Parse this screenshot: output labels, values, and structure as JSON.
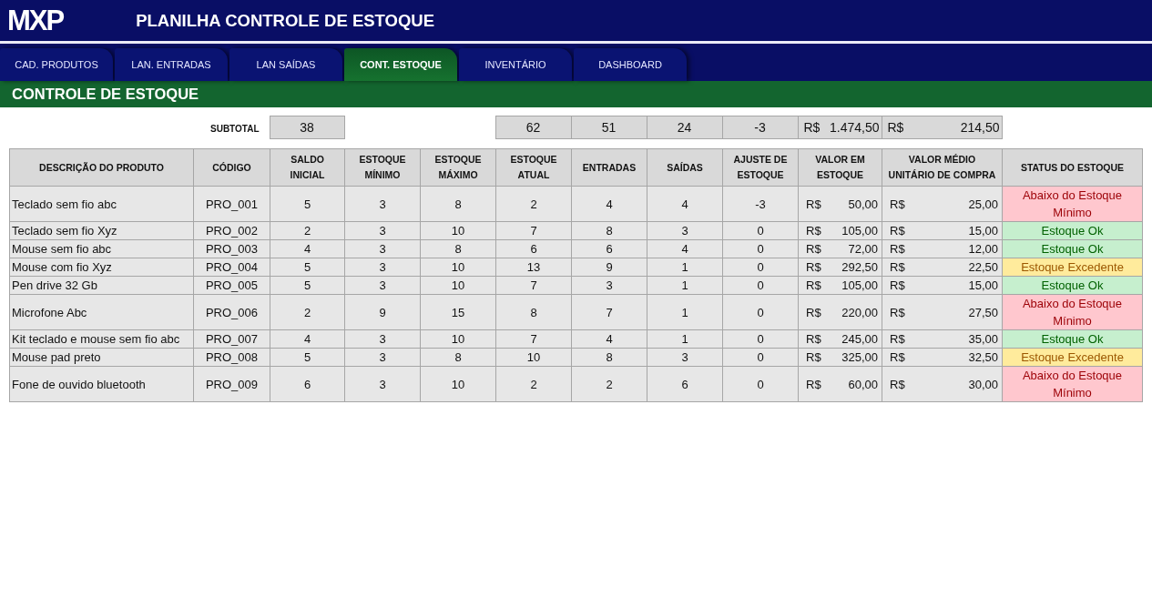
{
  "header": {
    "logo": "MXP",
    "title": "PLANILHA CONTROLE DE ESTOQUE"
  },
  "tabs": [
    {
      "label": "CAD. PRODUTOS",
      "selected": false
    },
    {
      "label": "LAN. ENTRADAS",
      "selected": false
    },
    {
      "label": "LAN SAÍDAS",
      "selected": false
    },
    {
      "label": "CONT. ESTOQUE",
      "selected": true
    },
    {
      "label": "INVENTÁRIO",
      "selected": false
    },
    {
      "label": "DASHBOARD",
      "selected": false
    }
  ],
  "section_title": "CONTROLE DE ESTOQUE",
  "subtotal": {
    "label": "SUBTOTAL",
    "saldo_inicial": "38",
    "estoque_atual": "62",
    "entradas": "51",
    "saidas": "24",
    "ajuste": "-3",
    "valor_em_estoque": {
      "currency": "R$",
      "amount": "1.474,50"
    },
    "valor_medio": {
      "currency": "R$",
      "amount": "214,50"
    }
  },
  "table": {
    "columns": [
      "DESCRIÇÃO DO PRODUTO",
      "CÓDIGO",
      "SALDO INICIAL",
      "ESTOQUE MÍNIMO",
      "ESTOQUE MÁXIMO",
      "ESTOQUE ATUAL",
      "ENTRADAS",
      "SAÍDAS",
      "AJUSTE DE ESTOQUE",
      "VALOR EM ESTOQUE",
      "VALOR MÉDIO UNITÁRIO DE COMPRA",
      "STATUS DO ESTOQUE"
    ],
    "rows": [
      {
        "descricao": "Teclado sem fio abc",
        "codigo": "PRO_001",
        "saldo_inicial": "5",
        "estoque_minimo": "3",
        "estoque_maximo": "8",
        "estoque_atual": "2",
        "entradas": "4",
        "saidas": "4",
        "ajuste": "-3",
        "valor_em_estoque": {
          "currency": "R$",
          "amount": "50,00"
        },
        "valor_medio": {
          "currency": "R$",
          "amount": "25,00"
        },
        "status": {
          "label": "Abaixo do Estoque Mínimo",
          "kind": "low"
        }
      },
      {
        "descricao": "Teclado sem fio Xyz",
        "codigo": "PRO_002",
        "saldo_inicial": "2",
        "estoque_minimo": "3",
        "estoque_maximo": "10",
        "estoque_atual": "7",
        "entradas": "8",
        "saidas": "3",
        "ajuste": "0",
        "valor_em_estoque": {
          "currency": "R$",
          "amount": "105,00"
        },
        "valor_medio": {
          "currency": "R$",
          "amount": "15,00"
        },
        "status": {
          "label": "Estoque Ok",
          "kind": "ok"
        }
      },
      {
        "descricao": "Mouse sem fio abc",
        "codigo": "PRO_003",
        "saldo_inicial": "4",
        "estoque_minimo": "3",
        "estoque_maximo": "8",
        "estoque_atual": "6",
        "entradas": "6",
        "saidas": "4",
        "ajuste": "0",
        "valor_em_estoque": {
          "currency": "R$",
          "amount": "72,00"
        },
        "valor_medio": {
          "currency": "R$",
          "amount": "12,00"
        },
        "status": {
          "label": "Estoque Ok",
          "kind": "ok"
        }
      },
      {
        "descricao": "Mouse com fio Xyz",
        "codigo": "PRO_004",
        "saldo_inicial": "5",
        "estoque_minimo": "3",
        "estoque_maximo": "10",
        "estoque_atual": "13",
        "entradas": "9",
        "saidas": "1",
        "ajuste": "0",
        "valor_em_estoque": {
          "currency": "R$",
          "amount": "292,50"
        },
        "valor_medio": {
          "currency": "R$",
          "amount": "22,50"
        },
        "status": {
          "label": "Estoque Excedente",
          "kind": "excess"
        }
      },
      {
        "descricao": "Pen drive 32 Gb",
        "codigo": "PRO_005",
        "saldo_inicial": "5",
        "estoque_minimo": "3",
        "estoque_maximo": "10",
        "estoque_atual": "7",
        "entradas": "3",
        "saidas": "1",
        "ajuste": "0",
        "valor_em_estoque": {
          "currency": "R$",
          "amount": "105,00"
        },
        "valor_medio": {
          "currency": "R$",
          "amount": "15,00"
        },
        "status": {
          "label": "Estoque Ok",
          "kind": "ok"
        }
      },
      {
        "descricao": "Microfone Abc",
        "codigo": "PRO_006",
        "saldo_inicial": "2",
        "estoque_minimo": "9",
        "estoque_maximo": "15",
        "estoque_atual": "8",
        "entradas": "7",
        "saidas": "1",
        "ajuste": "0",
        "valor_em_estoque": {
          "currency": "R$",
          "amount": "220,00"
        },
        "valor_medio": {
          "currency": "R$",
          "amount": "27,50"
        },
        "status": {
          "label": "Abaixo do Estoque Mínimo",
          "kind": "low"
        }
      },
      {
        "descricao": "Kit teclado e mouse sem fio abc",
        "codigo": "PRO_007",
        "saldo_inicial": "4",
        "estoque_minimo": "3",
        "estoque_maximo": "10",
        "estoque_atual": "7",
        "entradas": "4",
        "saidas": "1",
        "ajuste": "0",
        "valor_em_estoque": {
          "currency": "R$",
          "amount": "245,00"
        },
        "valor_medio": {
          "currency": "R$",
          "amount": "35,00"
        },
        "status": {
          "label": "Estoque Ok",
          "kind": "ok"
        }
      },
      {
        "descricao": "Mouse pad preto",
        "codigo": "PRO_008",
        "saldo_inicial": "5",
        "estoque_minimo": "3",
        "estoque_maximo": "8",
        "estoque_atual": "10",
        "entradas": "8",
        "saidas": "3",
        "ajuste": "0",
        "valor_em_estoque": {
          "currency": "R$",
          "amount": "325,00"
        },
        "valor_medio": {
          "currency": "R$",
          "amount": "32,50"
        },
        "status": {
          "label": "Estoque Excedente",
          "kind": "excess"
        }
      },
      {
        "descricao": "Fone de ouvido bluetooth",
        "codigo": "PRO_009",
        "saldo_inicial": "6",
        "estoque_minimo": "3",
        "estoque_maximo": "10",
        "estoque_atual": "2",
        "entradas": "2",
        "saidas": "6",
        "ajuste": "0",
        "valor_em_estoque": {
          "currency": "R$",
          "amount": "60,00"
        },
        "valor_medio": {
          "currency": "R$",
          "amount": "30,00"
        },
        "status": {
          "label": "Abaixo do Estoque Mínimo",
          "kind": "low"
        }
      }
    ]
  }
}
